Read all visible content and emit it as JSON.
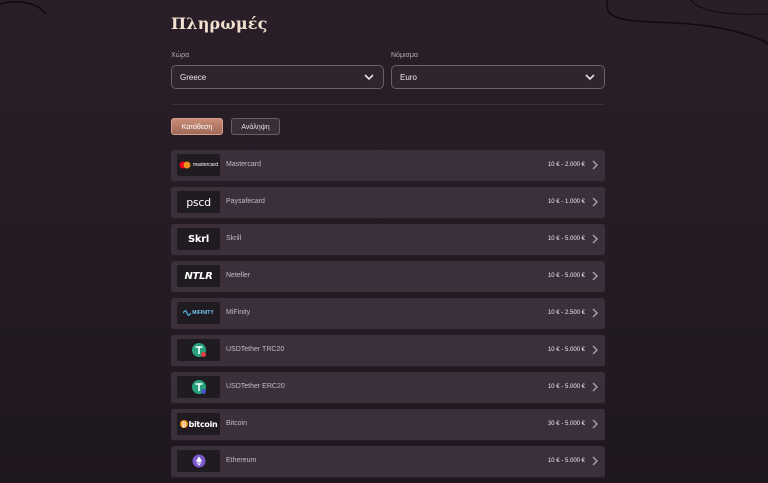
{
  "page": {
    "title": "Πληρωμές"
  },
  "filters": {
    "country": {
      "label": "Χώρα",
      "value": "Greece"
    },
    "currency": {
      "label": "Νόμισμα",
      "value": "Euro"
    }
  },
  "tabs": {
    "deposit": "Κατάθεση",
    "withdraw": "Ανάληψη"
  },
  "methods": [
    {
      "name": "Mastercard",
      "limits": "10 € - 2.000 €",
      "logo": "mastercard"
    },
    {
      "name": "Paysafecard",
      "limits": "10 € - 1.000 €",
      "logo": "pscd"
    },
    {
      "name": "Skrill",
      "limits": "10 € - 5.000 €",
      "logo": "Skrl"
    },
    {
      "name": "Neteller",
      "limits": "10 € - 5.000 €",
      "logo": "NTLR"
    },
    {
      "name": "MiFinity",
      "limits": "10 € - 2.500 €",
      "logo": "MiFINITY"
    },
    {
      "name": "USDTether TRC20",
      "limits": "10 € - 5.000 €",
      "logo": "tether-icon"
    },
    {
      "name": "USDTether ERC20",
      "limits": "10 € - 5.000 €",
      "logo": "tether-icon"
    },
    {
      "name": "Bitcoin",
      "limits": "30 € - 5.000 €",
      "logo": "bitcoin"
    },
    {
      "name": "Ethereum",
      "limits": "10 € - 5.000 €",
      "logo": "ethereum-icon"
    }
  ]
}
